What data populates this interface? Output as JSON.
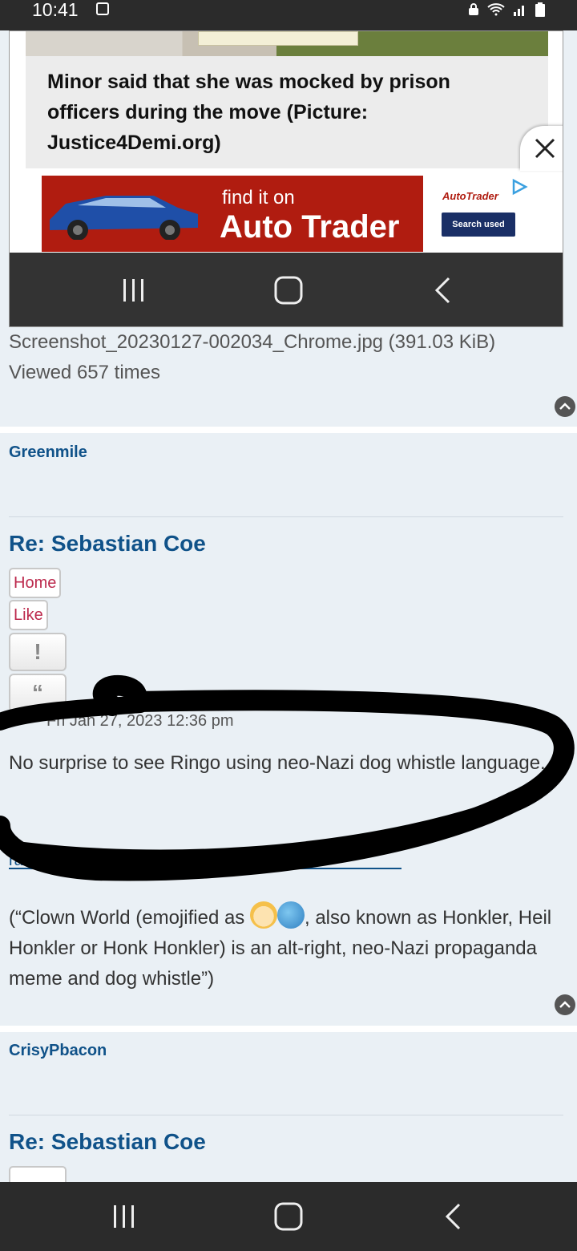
{
  "status_bar": {
    "time": "10:41"
  },
  "screenshot": {
    "caption": "Minor said that she was mocked by prison officers during the move (Picture: Justice4Demi.org)",
    "ad": {
      "line1": "find it on",
      "line2": "Auto Trader",
      "brand": "AutoTrader",
      "button": "Search used"
    }
  },
  "attachment": {
    "filename": "Screenshot_20230127-002034_Chrome.jpg (391.03 KiB)",
    "views": "Viewed 657 times"
  },
  "posts": [
    {
      "username": "Greenmile",
      "title": "Re: Sebastian Coe",
      "buttons": {
        "home": "Home",
        "like": "Like",
        "report": "!",
        "quote": "“"
      },
      "date": "Fri Jan 27, 2023 12:36 pm",
      "body": "No surprise to see Ringo using neo-Nazi dog whistle language.",
      "link": "rationalwiki.org/wiki/Clown_World",
      "quote_before_emoji": "(“Clown World (emojified as ",
      "quote_after_emoji": ", also known as Honkler, Heil Honkler or Honk Honkler) is an alt-right, neo-Nazi propaganda meme and dog whistle”)"
    },
    {
      "username": "CrisyPbacon",
      "title": "Re: Sebastian Coe"
    }
  ],
  "icons": {
    "close": "close-icon",
    "recents": "recents-icon",
    "home": "home-icon",
    "back": "back-icon",
    "scroll_top": "chevron-up-icon",
    "clown_emoji": "clown-face-emoji",
    "globe_emoji": "globe-emoji"
  },
  "colors": {
    "link": "#105289",
    "accent": "#bc2a4d",
    "ad_red": "#b01c10"
  }
}
